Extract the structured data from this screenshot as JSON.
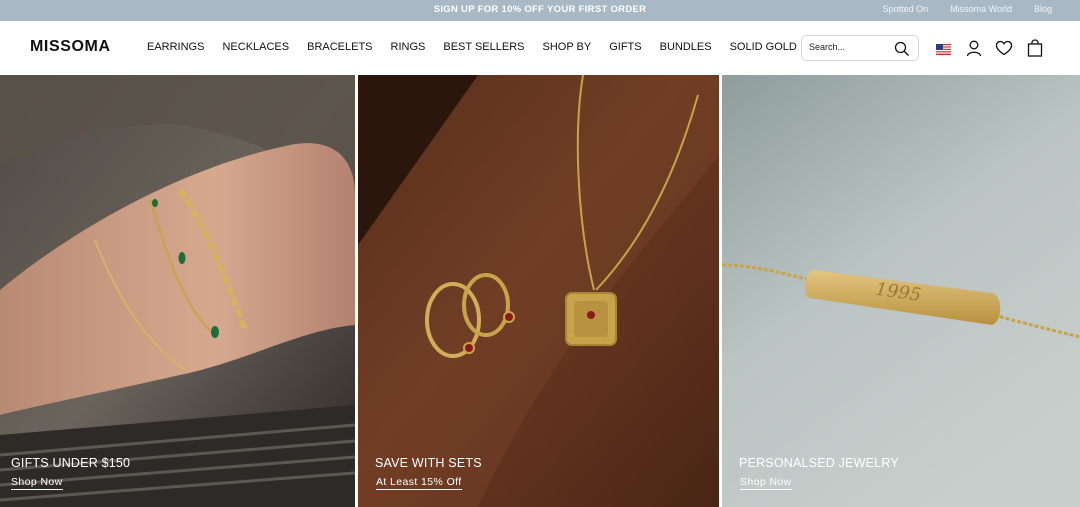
{
  "promo": {
    "message": "SIGN UP FOR 10% OFF YOUR FIRST ORDER",
    "links": [
      "Spotted On",
      "Missoma World",
      "Blog"
    ]
  },
  "header": {
    "logo": "MISSOMA",
    "nav": [
      "EARRINGS",
      "NECKLACES",
      "BRACELETS",
      "RINGS",
      "BEST SELLERS",
      "SHOP BY",
      "GIFTS",
      "BUNDLES",
      "SOLID GOLD"
    ],
    "search_placeholder": "Search...",
    "icons": [
      "search-icon",
      "us-flag-icon",
      "account-icon",
      "wishlist-heart-icon",
      "bag-icon"
    ]
  },
  "hero": {
    "panels": [
      {
        "title": "GIFTS UNDER $150",
        "link": "Shop Now"
      },
      {
        "title": "SAVE WITH SETS",
        "link": "At Least 15% Off"
      },
      {
        "title": "PERSONALSED JEWELRY",
        "link": "Shop Now",
        "engraving": "1995"
      }
    ]
  },
  "colors": {
    "promo_bg": "#a8b8c5",
    "panel1_bg": "#5e5750",
    "panel2_bg": "#5a2f1b",
    "panel3_bg": "#b8c2c0",
    "gold": "#c9a34a"
  }
}
